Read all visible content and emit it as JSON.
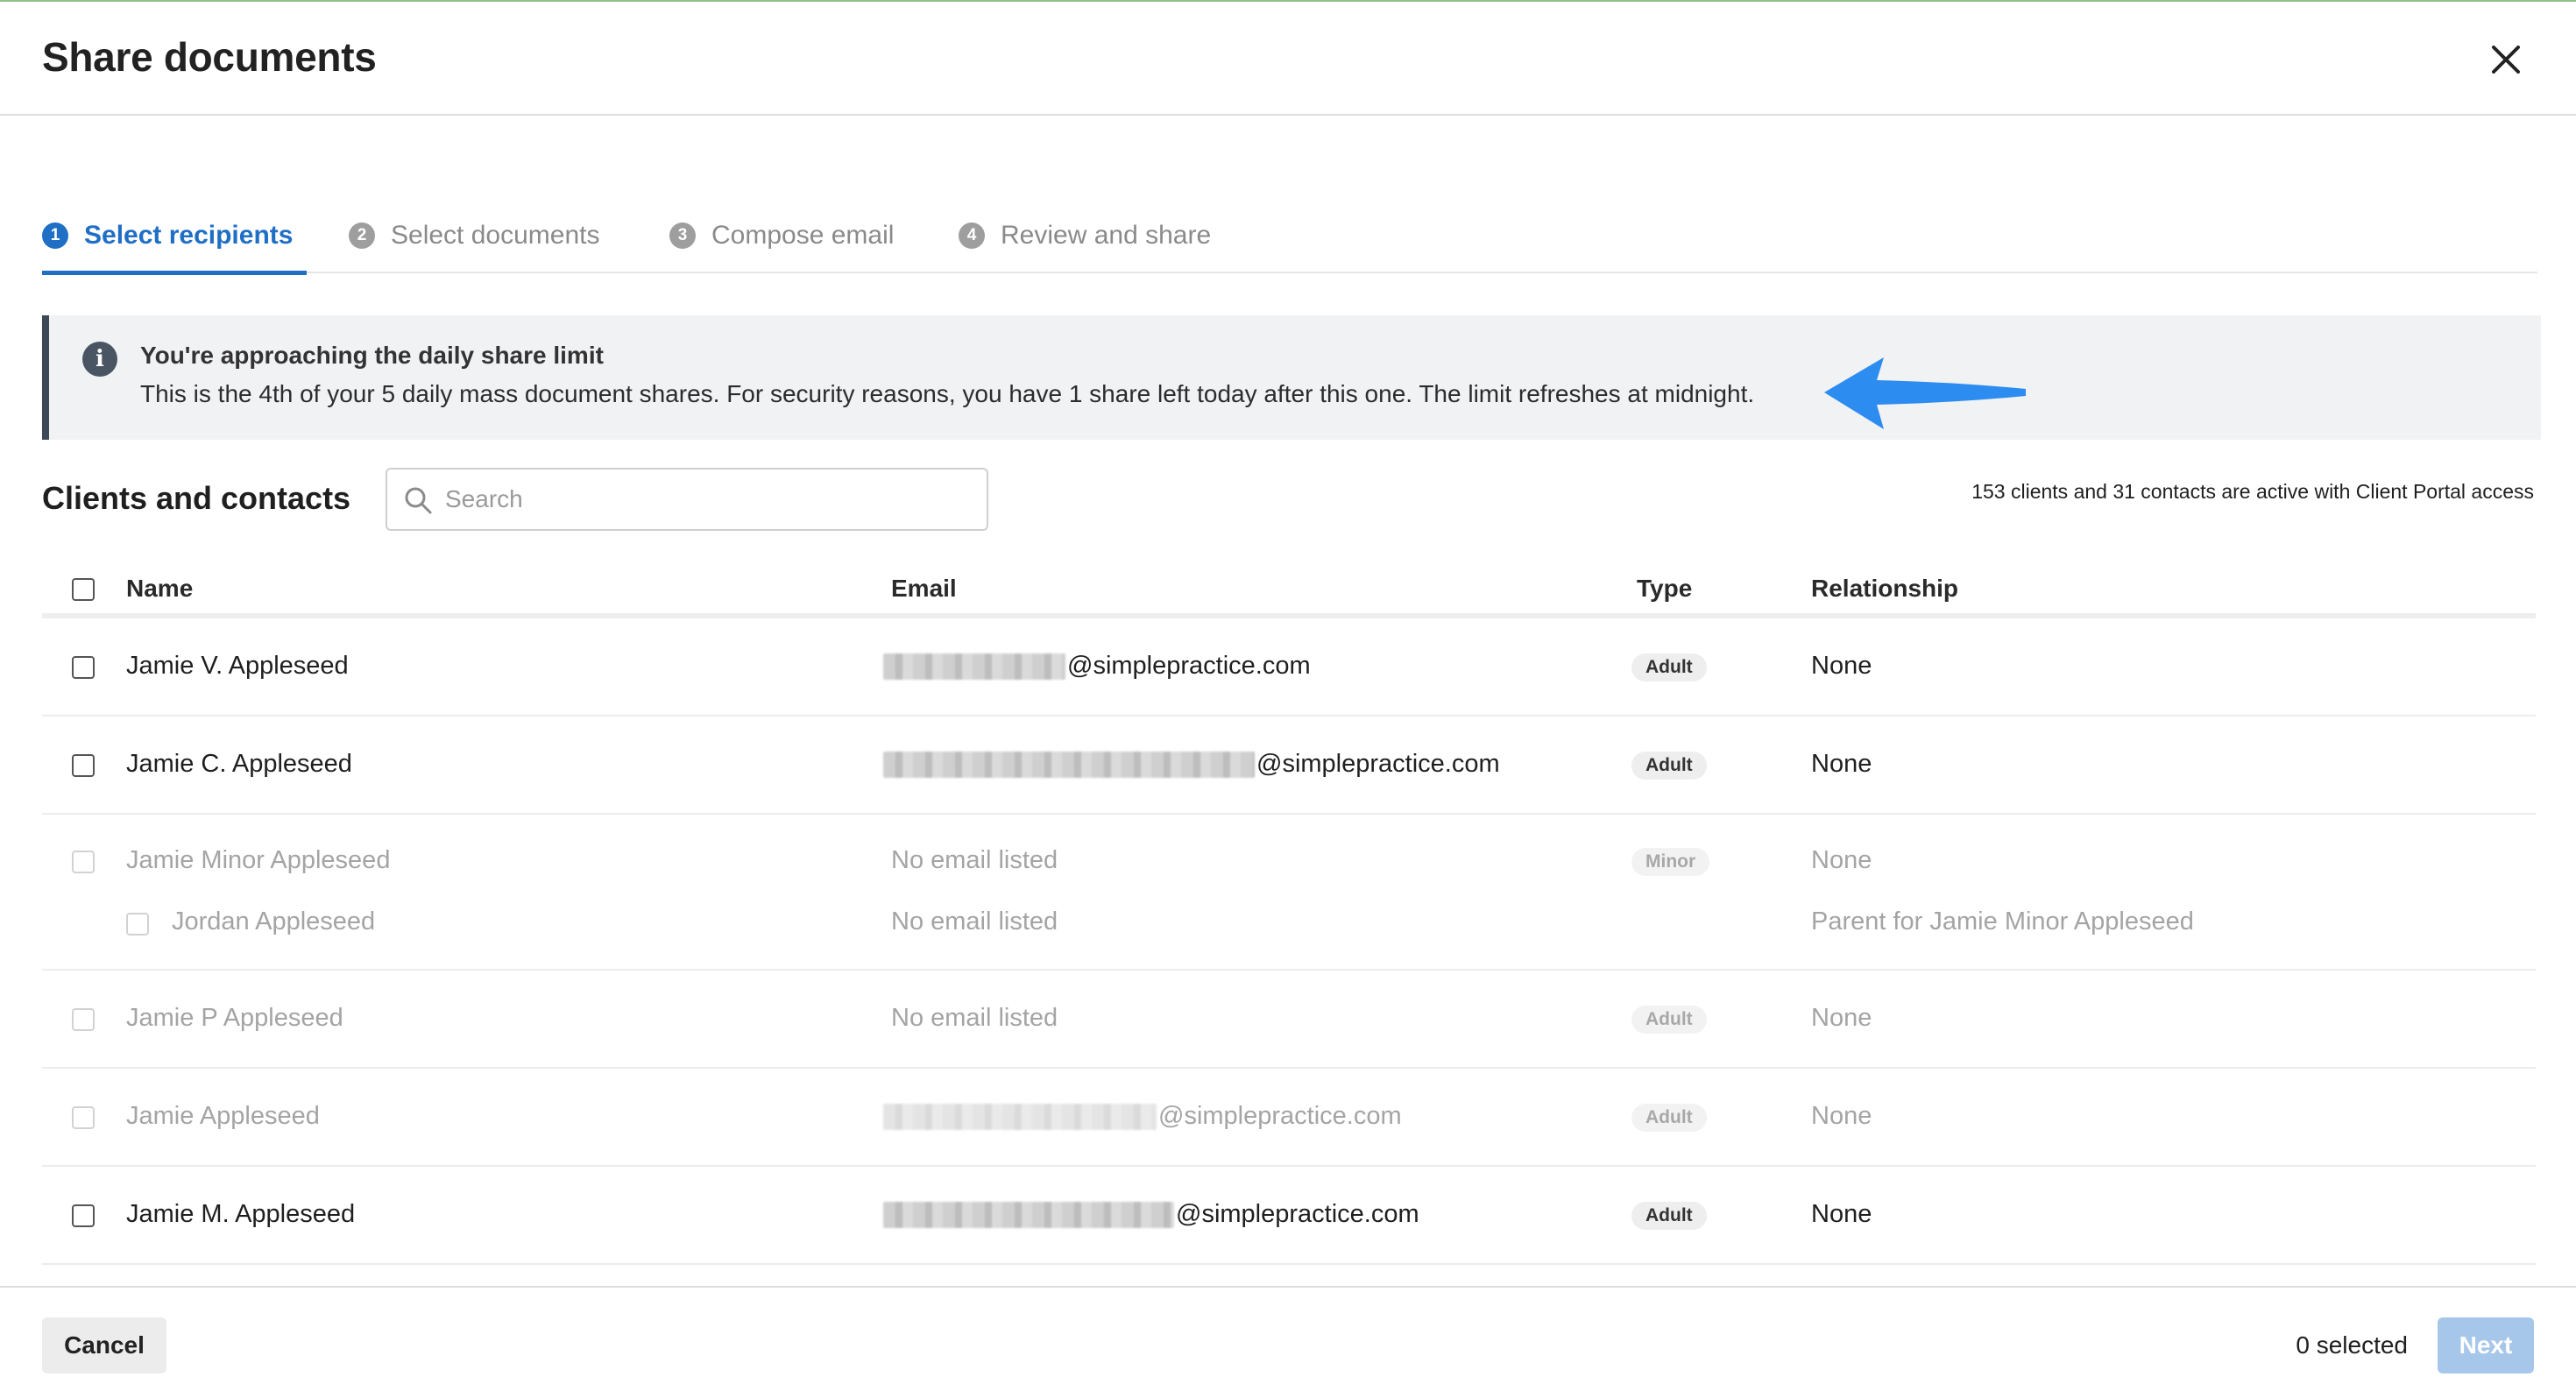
{
  "header": {
    "title": "Share documents"
  },
  "steps": [
    {
      "num": "1",
      "label": "Select recipients"
    },
    {
      "num": "2",
      "label": "Select documents"
    },
    {
      "num": "3",
      "label": "Compose email"
    },
    {
      "num": "4",
      "label": "Review and share"
    }
  ],
  "alert": {
    "icon": "info-icon",
    "title": "You're approaching the daily share limit",
    "text": "This is the 4th of your 5 daily mass document shares. For security reasons, you have 1 share left today after this one. The limit refreshes at midnight."
  },
  "section": {
    "title": "Clients and contacts",
    "search_placeholder": "Search",
    "active_count": "153 clients and 31 contacts are active with Client Portal access"
  },
  "table": {
    "columns": [
      "Name",
      "Email",
      "Type",
      "Relationship"
    ],
    "rows": [
      {
        "name": "Jamie V. Appleseed",
        "email_domain": "@simplepractice.com",
        "type": "Adult",
        "relationship": "None"
      },
      {
        "name": "Jamie C. Appleseed",
        "email_domain": "@simplepractice.com",
        "type": "Adult",
        "relationship": "None"
      },
      {
        "name": "Jamie Minor Appleseed",
        "email": "No email listed",
        "type": "Minor",
        "relationship": "None"
      },
      {
        "name": "Jordan Appleseed",
        "email": "No email listed",
        "relationship": "Parent for Jamie Minor Appleseed"
      },
      {
        "name": "Jamie P Appleseed",
        "email": "No email listed",
        "type": "Adult",
        "relationship": "None"
      },
      {
        "name": "Jamie Appleseed",
        "email_domain": "@simplepractice.com",
        "type": "Adult",
        "relationship": "None"
      },
      {
        "name": "Jamie M. Appleseed",
        "email_domain": "@simplepractice.com",
        "type": "Adult",
        "relationship": "None"
      }
    ]
  },
  "footer": {
    "cancel_label": "Cancel",
    "selected_text": "0 selected",
    "next_label": "Next"
  },
  "colors": {
    "accent": "#1f6fc5",
    "next_disabled": "#a7c7ea",
    "alert_border": "#3d4956",
    "arrow": "#2d8cf0"
  }
}
